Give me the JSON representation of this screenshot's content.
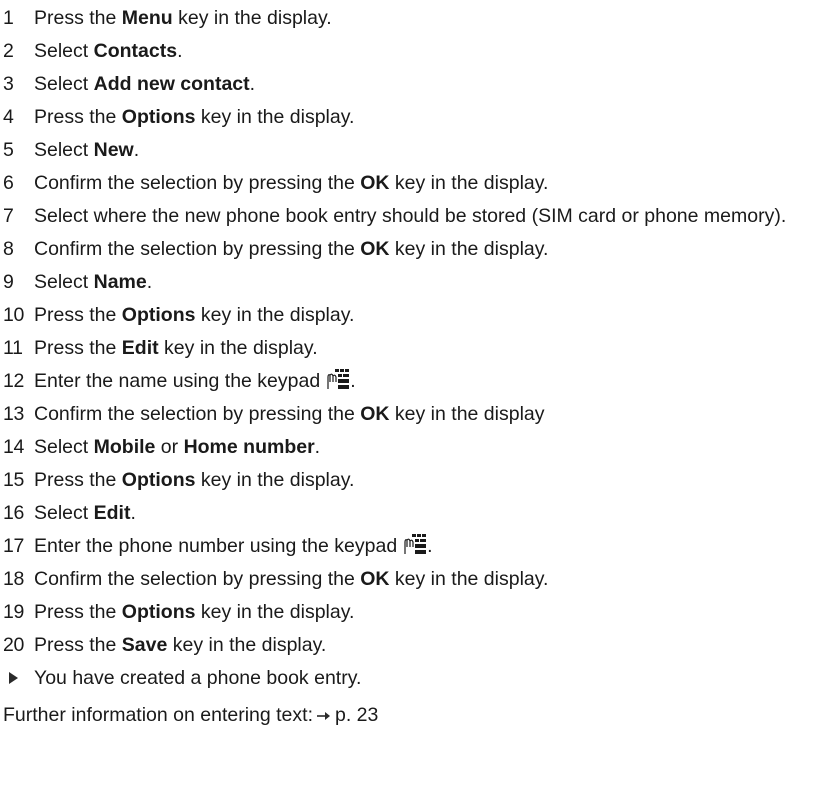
{
  "steps": [
    {
      "num": "1",
      "parts": [
        {
          "t": "Press the "
        },
        {
          "b": "Menu"
        },
        {
          "t": " key in the display."
        }
      ]
    },
    {
      "num": "2",
      "parts": [
        {
          "t": "Select "
        },
        {
          "b": "Contacts"
        },
        {
          "t": "."
        }
      ]
    },
    {
      "num": "3",
      "parts": [
        {
          "t": "Select "
        },
        {
          "b": "Add new contact"
        },
        {
          "t": "."
        }
      ]
    },
    {
      "num": "4",
      "parts": [
        {
          "t": "Press the "
        },
        {
          "b": "Options"
        },
        {
          "t": " key in the display."
        }
      ]
    },
    {
      "num": "5",
      "parts": [
        {
          "t": "Select "
        },
        {
          "b": "New"
        },
        {
          "t": "."
        }
      ]
    },
    {
      "num": "6",
      "parts": [
        {
          "t": "Confirm the selection by pressing the "
        },
        {
          "b": "OK"
        },
        {
          "t": " key in the display."
        }
      ]
    },
    {
      "num": "7",
      "parts": [
        {
          "t": "Select where the new phone book entry should be stored (SIM card or phone memory)."
        }
      ]
    },
    {
      "num": "8",
      "parts": [
        {
          "t": "Confirm the selection by pressing the "
        },
        {
          "b": "OK"
        },
        {
          "t": " key in the display."
        }
      ]
    },
    {
      "num": "9",
      "parts": [
        {
          "t": "Select "
        },
        {
          "b": "Name"
        },
        {
          "t": "."
        }
      ]
    },
    {
      "num": "10",
      "parts": [
        {
          "t": "Press the "
        },
        {
          "b": "Options"
        },
        {
          "t": " key in the display."
        }
      ]
    },
    {
      "num": "11",
      "parts": [
        {
          "t": "Press the "
        },
        {
          "b": "Edit"
        },
        {
          "t": " key in the display."
        }
      ]
    },
    {
      "num": "12",
      "parts": [
        {
          "t": "Enter the name using the keypad"
        },
        {
          "icon": "keypad-icon"
        },
        {
          "t": "."
        }
      ]
    },
    {
      "num": "13",
      "parts": [
        {
          "t": "Confirm the selection by pressing the "
        },
        {
          "b": "OK"
        },
        {
          "t": " key in the display"
        }
      ]
    },
    {
      "num": "14",
      "parts": [
        {
          "t": "Select "
        },
        {
          "b": "Mobile"
        },
        {
          "t": " or "
        },
        {
          "b": "Home number"
        },
        {
          "t": "."
        }
      ]
    },
    {
      "num": "15",
      "parts": [
        {
          "t": "Press the "
        },
        {
          "b": "Options"
        },
        {
          "t": " key in the display."
        }
      ]
    },
    {
      "num": "16",
      "parts": [
        {
          "t": "Select "
        },
        {
          "b": "Edit"
        },
        {
          "t": "."
        }
      ]
    },
    {
      "num": "17",
      "parts": [
        {
          "t": "Enter the phone number using the keypad"
        },
        {
          "icon": "keypad-icon"
        },
        {
          "t": "."
        }
      ]
    },
    {
      "num": "18",
      "parts": [
        {
          "t": "Confirm the selection by pressing the "
        },
        {
          "b": "OK"
        },
        {
          "t": " key in the display."
        }
      ]
    },
    {
      "num": "19",
      "parts": [
        {
          "t": "Press the "
        },
        {
          "b": "Options"
        },
        {
          "t": " key in the display."
        }
      ]
    },
    {
      "num": "20",
      "parts": [
        {
          "t": "Press the "
        },
        {
          "b": "Save"
        },
        {
          "t": " key in the display."
        }
      ]
    }
  ],
  "result": {
    "icon": "play-triangle-icon",
    "text": "You have created a phone book entry."
  },
  "further_info": {
    "text": "Further information on entering text:",
    "arrow_icon": "right-arrow-icon",
    "page_ref": "p. 23"
  }
}
